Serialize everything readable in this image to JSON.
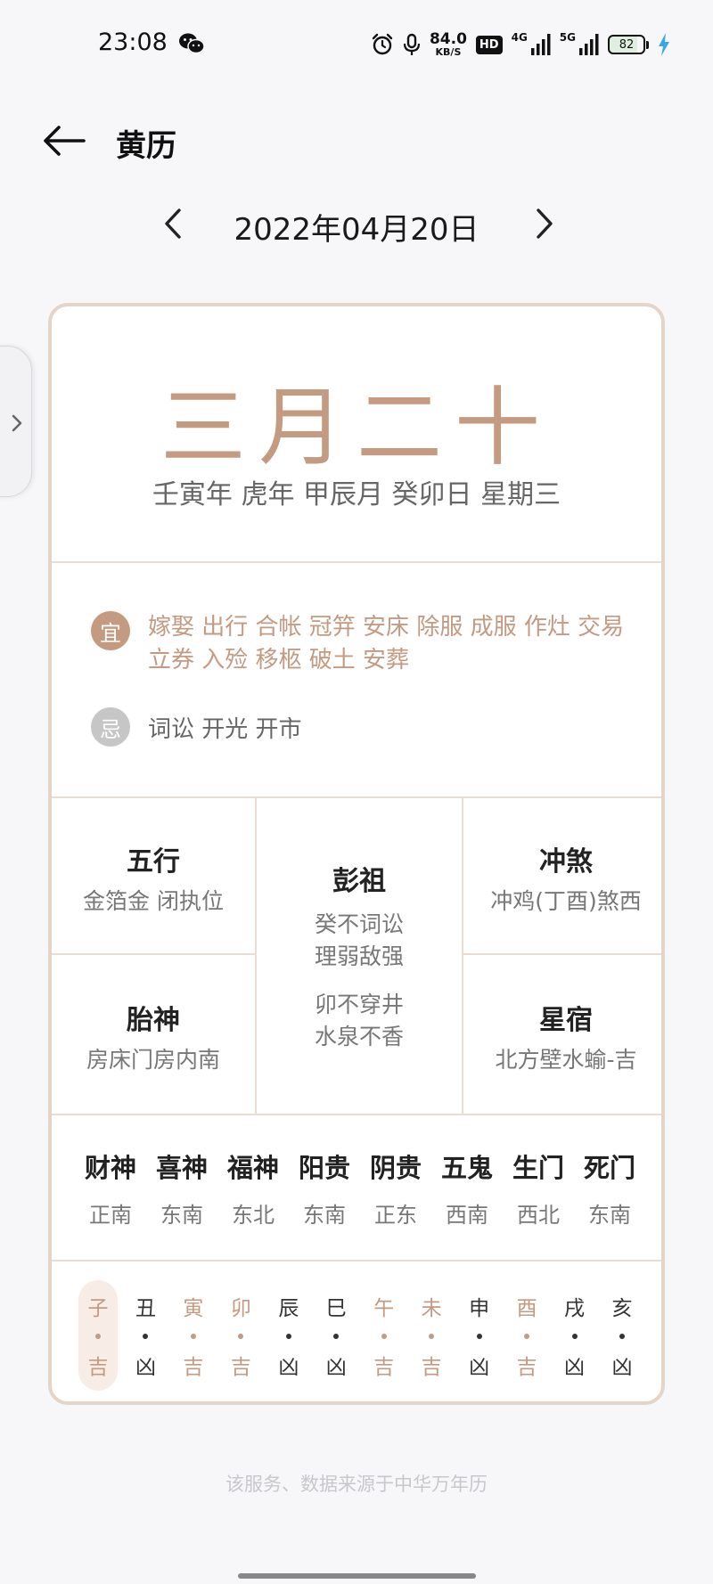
{
  "status_bar": {
    "time": "23:08",
    "net_speed_value": "84.0",
    "net_speed_unit": "KB/S",
    "hd_label": "HD",
    "net1_label": "4G",
    "net2_label": "5G",
    "battery_level": "82",
    "icons": [
      "wechat-icon",
      "alarm-icon",
      "mic-icon",
      "signal-icon",
      "charging-bolt-icon"
    ]
  },
  "header": {
    "title": "黄历"
  },
  "date_nav": {
    "date": "2022年04月20日"
  },
  "card": {
    "lunar_date": "三月二十",
    "ganzhi": "壬寅年 虎年 甲辰月 癸卯日 星期三",
    "yi_label": "宜",
    "yi_items": "嫁娶 出行 合帐 冠笄 安床 除服 成服 作灶 交易 立券 入殓 移柩 破土 安葬",
    "ji_label": "忌",
    "ji_items": "词讼 开光 开市",
    "wuxing": {
      "title": "五行",
      "value": "金箔金 闭执位"
    },
    "pengzu": {
      "title": "彭祖",
      "line1": "癸不词讼",
      "line2": "理弱敌强",
      "line3": "卯不穿井",
      "line4": "水泉不香"
    },
    "chongsha": {
      "title": "冲煞",
      "value": "冲鸡(丁酉)煞西"
    },
    "taishen": {
      "title": "胎神",
      "value": "房床门房内南"
    },
    "xingxiu": {
      "title": "星宿",
      "value": "北方壁水蝓-吉"
    },
    "gods": [
      {
        "name": "财神",
        "dir": "正南"
      },
      {
        "name": "喜神",
        "dir": "东南"
      },
      {
        "name": "福神",
        "dir": "东北"
      },
      {
        "name": "阳贵",
        "dir": "东南"
      },
      {
        "name": "阴贵",
        "dir": "正东"
      },
      {
        "name": "五鬼",
        "dir": "西南"
      },
      {
        "name": "生门",
        "dir": "西北"
      },
      {
        "name": "死门",
        "dir": "东南"
      }
    ],
    "hours": [
      {
        "branch": "子",
        "luck": "吉",
        "good": true,
        "current": true
      },
      {
        "branch": "丑",
        "luck": "凶",
        "good": false,
        "current": false
      },
      {
        "branch": "寅",
        "luck": "吉",
        "good": true,
        "current": false
      },
      {
        "branch": "卯",
        "luck": "吉",
        "good": true,
        "current": false
      },
      {
        "branch": "辰",
        "luck": "凶",
        "good": false,
        "current": false
      },
      {
        "branch": "巳",
        "luck": "凶",
        "good": false,
        "current": false
      },
      {
        "branch": "午",
        "luck": "吉",
        "good": true,
        "current": false
      },
      {
        "branch": "未",
        "luck": "吉",
        "good": true,
        "current": false
      },
      {
        "branch": "申",
        "luck": "凶",
        "good": false,
        "current": false
      },
      {
        "branch": "酉",
        "luck": "吉",
        "good": true,
        "current": false
      },
      {
        "branch": "戌",
        "luck": "凶",
        "good": false,
        "current": false
      },
      {
        "branch": "亥",
        "luck": "凶",
        "good": false,
        "current": false
      }
    ]
  },
  "footer": {
    "note": "该服务、数据来源于中华万年历"
  },
  "colors": {
    "accent": "#c49a81",
    "good": "#c49a81",
    "bad": "#333333",
    "ji_badge": "#c6c6c6",
    "card_border": "#e6d4c8"
  }
}
